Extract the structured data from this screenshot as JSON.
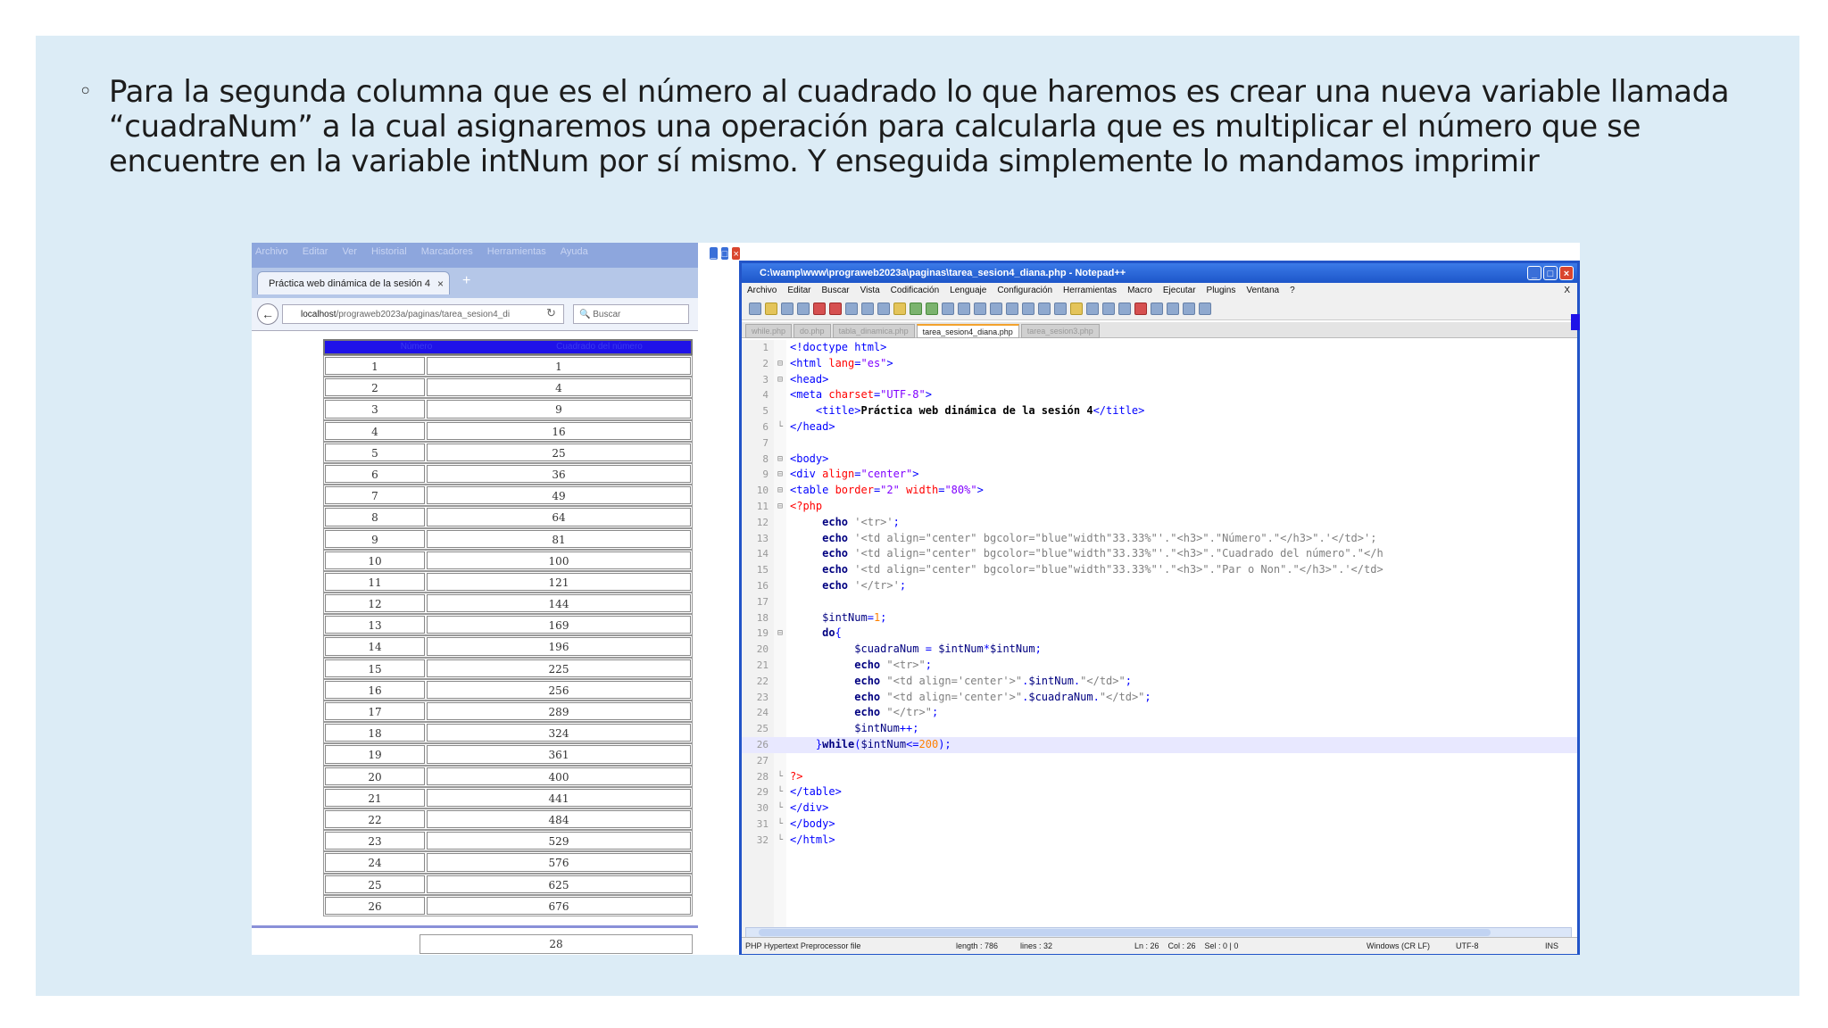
{
  "slide": {
    "bullet": "◦",
    "paragraph": "Para la segunda columna que es el número al cuadrado lo que haremos es crear una nueva variable llamada “cuadraNum” a la cual asignaremos una operación para calcularla que es multiplicar el número que se encuentre en la variable intNum por sí mismo. Y enseguida simplemente lo mandamos imprimir"
  },
  "firefox": {
    "menu": [
      "Archivo",
      "Editar",
      "Ver",
      "Historial",
      "Marcadores",
      "Herramientas",
      "Ayuda"
    ],
    "tab_title": "Práctica web dinámica de la sesión 4",
    "tab_close": "×",
    "new_tab": "+",
    "url_host": "localhost",
    "url_path": "/prograweb2023a/paginas/tarea_sesion4_di",
    "search_placeholder": "Buscar",
    "table_headers": [
      "Número",
      "Cuadrado del número"
    ],
    "rows": [
      [
        "1",
        "1"
      ],
      [
        "2",
        "4"
      ],
      [
        "3",
        "9"
      ],
      [
        "4",
        "16"
      ],
      [
        "5",
        "25"
      ],
      [
        "6",
        "36"
      ],
      [
        "7",
        "49"
      ],
      [
        "8",
        "64"
      ],
      [
        "9",
        "81"
      ],
      [
        "10",
        "100"
      ],
      [
        "11",
        "121"
      ],
      [
        "12",
        "144"
      ],
      [
        "13",
        "169"
      ],
      [
        "14",
        "196"
      ],
      [
        "15",
        "225"
      ],
      [
        "16",
        "256"
      ],
      [
        "17",
        "289"
      ],
      [
        "18",
        "324"
      ],
      [
        "19",
        "361"
      ],
      [
        "20",
        "400"
      ],
      [
        "21",
        "441"
      ],
      [
        "22",
        "484"
      ],
      [
        "23",
        "529"
      ],
      [
        "24",
        "576"
      ],
      [
        "25",
        "625"
      ],
      [
        "26",
        "676"
      ]
    ],
    "last_row_value": "28"
  },
  "notepad": {
    "title": "C:\\wamp\\www\\prograweb2023a\\paginas\\tarea_sesion4_diana.php - Notepad++",
    "menu": [
      "Archivo",
      "Editar",
      "Buscar",
      "Vista",
      "Codificación",
      "Lenguaje",
      "Configuración",
      "Herramientas",
      "Macro",
      "Ejecutar",
      "Plugins",
      "Ventana",
      "?"
    ],
    "close_x": "X",
    "tabs": [
      {
        "label": "while.php",
        "active": false
      },
      {
        "label": "do.php",
        "active": false
      },
      {
        "label": "tabla_dinamica.php",
        "active": false
      },
      {
        "label": "tarea_sesion4_diana.php",
        "active": true
      },
      {
        "label": "tarea_sesion3.php",
        "active": false
      }
    ],
    "lines": [
      {
        "n": "1",
        "f": "",
        "h": "<span class='tag'>&lt;!doctype html&gt;</span>"
      },
      {
        "n": "2",
        "f": "⊟",
        "h": "<span class='tag'>&lt;html </span><span class='attr'>lang</span><span class='tag'>=</span><span class='str'>\"es\"</span><span class='tag'>&gt;</span>"
      },
      {
        "n": "3",
        "f": "⊟",
        "h": "<span class='tag'>&lt;head&gt;</span>"
      },
      {
        "n": "4",
        "f": "",
        "h": "<span class='tag'>&lt;meta </span><span class='attr'>charset</span><span class='tag'>=</span><span class='str'>\"UTF-8\"</span><span class='tag'>&gt;</span>"
      },
      {
        "n": "5",
        "f": "",
        "h": "    <span class='tag'>&lt;title&gt;</span><span class='txt'>Práctica web dinámica de la sesión 4</span><span class='tag'>&lt;/title&gt;</span>"
      },
      {
        "n": "6",
        "f": "└",
        "h": "<span class='tag'>&lt;/head&gt;</span>"
      },
      {
        "n": "7",
        "f": "",
        "h": ""
      },
      {
        "n": "8",
        "f": "⊟",
        "h": "<span class='tag'>&lt;body&gt;</span>"
      },
      {
        "n": "9",
        "f": "⊟",
        "h": "<span class='tag'>&lt;div </span><span class='attr'>align</span><span class='tag'>=</span><span class='str'>\"center\"</span><span class='tag'>&gt;</span>"
      },
      {
        "n": "10",
        "f": "⊟",
        "h": "<span class='tag'>&lt;table </span><span class='attr'>border</span><span class='tag'>=</span><span class='str'>\"2\"</span><span class='attr'> width</span><span class='tag'>=</span><span class='str'>\"80%\"</span><span class='tag'>&gt;</span>"
      },
      {
        "n": "11",
        "f": "⊟",
        "h": "<span class='php'>&lt;?php</span>"
      },
      {
        "n": "12",
        "f": "",
        "h": "     <span class='kw'>echo</span> <span class='pstr'>'&lt;tr&gt;'</span>;"
      },
      {
        "n": "13",
        "f": "",
        "h": "     <span class='kw'>echo</span> <span class='pstr'>'&lt;td align=\"center\" bgcolor=\"blue\"width\"33.33%\"'.\"&lt;h3&gt;\".\"Número\".\"&lt;/h3&gt;\".'&lt;/td&gt;';</span>"
      },
      {
        "n": "14",
        "f": "",
        "h": "     <span class='kw'>echo</span> <span class='pstr'>'&lt;td align=\"center\" bgcolor=\"blue\"width\"33.33%\"'.\"&lt;h3&gt;\".\"Cuadrado del número\".\"&lt;/h</span>"
      },
      {
        "n": "15",
        "f": "",
        "h": "     <span class='kw'>echo</span> <span class='pstr'>'&lt;td align=\"center\" bgcolor=\"blue\"width\"33.33%\"'.\"&lt;h3&gt;\".\"Par o Non\".\"&lt;/h3&gt;\".'&lt;/td&gt;</span>"
      },
      {
        "n": "16",
        "f": "",
        "h": "     <span class='kw'>echo</span> <span class='pstr'>'&lt;/tr&gt;'</span>;"
      },
      {
        "n": "17",
        "f": "",
        "h": ""
      },
      {
        "n": "18",
        "f": "",
        "h": "     <span class='var'>$intNum</span>=<span class='num'>1</span>;"
      },
      {
        "n": "19",
        "f": "⊟",
        "h": "     <span class='kw'>do</span>{"
      },
      {
        "n": "20",
        "f": "",
        "h": "          <span class='var'>$cuadraNum</span> = <span class='var'>$intNum</span>*<span class='var'>$intNum</span>;"
      },
      {
        "n": "21",
        "f": "",
        "h": "          <span class='kw'>echo</span> <span class='pstr'>\"&lt;tr&gt;\"</span>;"
      },
      {
        "n": "22",
        "f": "",
        "h": "          <span class='kw'>echo</span> <span class='pstr'>\"&lt;td align='center'&gt;\"</span>.<span class='var'>$intNum</span>.<span class='pstr'>\"&lt;/td&gt;\"</span>;"
      },
      {
        "n": "23",
        "f": "",
        "h": "          <span class='kw'>echo</span> <span class='pstr'>\"&lt;td align='center'&gt;\"</span>.<span class='var'>$cuadraNum</span>.<span class='pstr'>\"&lt;/td&gt;\"</span>;"
      },
      {
        "n": "24",
        "f": "",
        "h": "          <span class='kw'>echo</span> <span class='pstr'>\"&lt;/tr&gt;\"</span>;"
      },
      {
        "n": "25",
        "f": "",
        "h": "          <span class='var'>$intNum</span>++;"
      },
      {
        "n": "26",
        "f": "",
        "h": "    }<span class='kw'>while</span>(<span class='var'>$intNum</span>&lt;=<span class='num'>200</span>);",
        "cur": true
      },
      {
        "n": "27",
        "f": "",
        "h": ""
      },
      {
        "n": "28",
        "f": "└",
        "h": "<span class='php'>?&gt;</span>"
      },
      {
        "n": "29",
        "f": "└",
        "h": "<span class='tag'>&lt;/table&gt;</span>"
      },
      {
        "n": "30",
        "f": "└",
        "h": "<span class='tag'>&lt;/div&gt;</span>"
      },
      {
        "n": "31",
        "f": "└",
        "h": "<span class='tag'>&lt;/body&gt;</span>"
      },
      {
        "n": "32",
        "f": "└",
        "h": "<span class='tag'>&lt;/html&gt;</span>"
      }
    ],
    "status": {
      "type": "PHP Hypertext Preprocessor file",
      "length": "length : 786",
      "lines": "lines : 32",
      "pos": "Ln : 26    Col : 26    Sel : 0 | 0",
      "eol": "Windows (CR LF)",
      "enc": "UTF-8",
      "ins": "INS"
    }
  }
}
